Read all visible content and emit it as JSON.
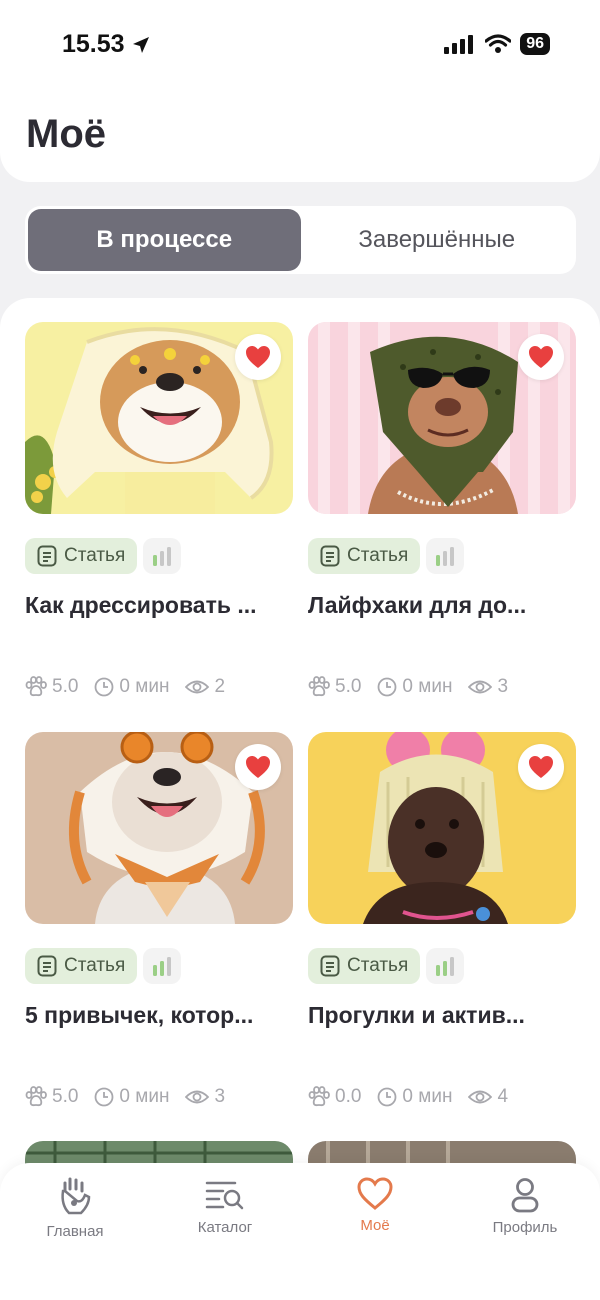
{
  "status_bar": {
    "time": "15.53",
    "battery": "96"
  },
  "header": {
    "title": "Моё"
  },
  "segments": [
    {
      "label": "В процессе",
      "active": true
    },
    {
      "label": "Завершённые",
      "active": false
    }
  ],
  "cards": [
    {
      "type_label": "Статья",
      "title": "Как дрессировать ...",
      "rating": "5.0",
      "duration": "0 мин",
      "views": "2",
      "favorite": true,
      "image": "shiba-yellow-scarf"
    },
    {
      "type_label": "Статья",
      "title": "Лайфхаки для до...",
      "rating": "5.0",
      "duration": "0 мин",
      "views": "3",
      "favorite": true,
      "image": "pitbull-green-scarf"
    },
    {
      "type_label": "Статья",
      "title": "5 привычек, котор...",
      "rating": "5.0",
      "duration": "0 мин",
      "views": "3",
      "favorite": true,
      "image": "frenchie-orange-scarf"
    },
    {
      "type_label": "Статья",
      "title": "Прогулки и актив...",
      "rating": "0.0",
      "duration": "0 мин",
      "views": "4",
      "favorite": true,
      "image": "spaniel-knit-hat"
    }
  ],
  "nav": [
    {
      "label": "Главная",
      "icon": "paw-hand-icon",
      "active": false
    },
    {
      "label": "Каталог",
      "icon": "catalog-search-icon",
      "active": false
    },
    {
      "label": "Моё",
      "icon": "heart-icon",
      "active": true
    },
    {
      "label": "Профиль",
      "icon": "profile-icon",
      "active": false
    }
  ],
  "colors": {
    "accent": "#e47a4c",
    "heart": "#e8403f",
    "tag_bg": "#e3efdc",
    "segment_active": "#6f6e79"
  }
}
